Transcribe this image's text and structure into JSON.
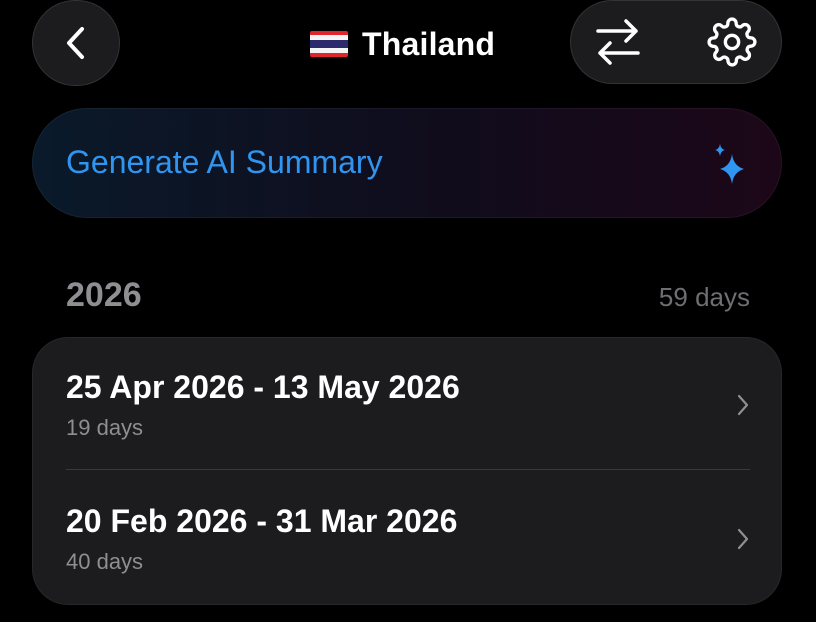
{
  "header": {
    "back_icon": "chevron-left-icon",
    "flag_icon": "thailand-flag-icon",
    "title": "Thailand",
    "swap_icon": "arrows-swap-icon",
    "settings_icon": "gear-icon"
  },
  "ai_summary": {
    "label": "Generate AI Summary",
    "icon": "sparkles-icon",
    "label_color": "#2f95f0"
  },
  "year_section": {
    "year": "2026",
    "total": "59 days"
  },
  "trips": [
    {
      "dates": "25 Apr 2026 - 13 May 2026",
      "duration": "19 days",
      "icon": "chevron-right-icon"
    },
    {
      "dates": "20 Feb 2026 - 31 Mar 2026",
      "duration": "40 days",
      "icon": "chevron-right-icon"
    }
  ]
}
